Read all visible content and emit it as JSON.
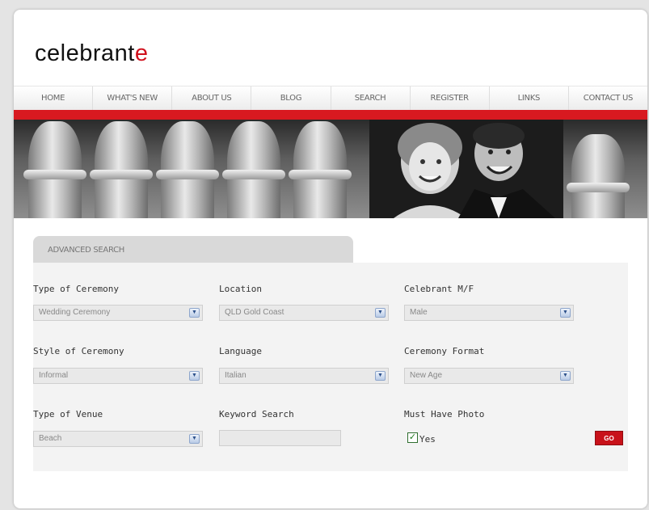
{
  "brand": {
    "logo_main": "celebrant",
    "logo_accent": "e"
  },
  "nav": [
    "HOME",
    "WHAT'S NEW",
    "ABOUT US",
    "BLOG",
    "SEARCH",
    "REGISTER",
    "LINKS",
    "CONTACT US"
  ],
  "search": {
    "tab_label": "ADVANCED SEARCH",
    "type_of_ceremony": {
      "label": "Type of Ceremony",
      "value": "Wedding Ceremony"
    },
    "location": {
      "label": "Location",
      "value": "QLD Gold Coast"
    },
    "celebrant_mf": {
      "label": "Celebrant M/F",
      "value": "Male"
    },
    "style_of_ceremony": {
      "label": "Style of Ceremony",
      "value": "Informal"
    },
    "language": {
      "label": "Language",
      "value": "Italian"
    },
    "ceremony_format": {
      "label": "Ceremony Format",
      "value": "New Age"
    },
    "type_of_venue": {
      "label": "Type of Venue",
      "value": "Beach"
    },
    "keyword": {
      "label": "Keyword Search",
      "value": ""
    },
    "must_have_photo": {
      "label": "Must Have Photo",
      "option_label": "Yes",
      "checked": true
    },
    "go_label": "GO"
  },
  "colors": {
    "brand_red": "#d81920",
    "go_button": "#c8121a"
  }
}
